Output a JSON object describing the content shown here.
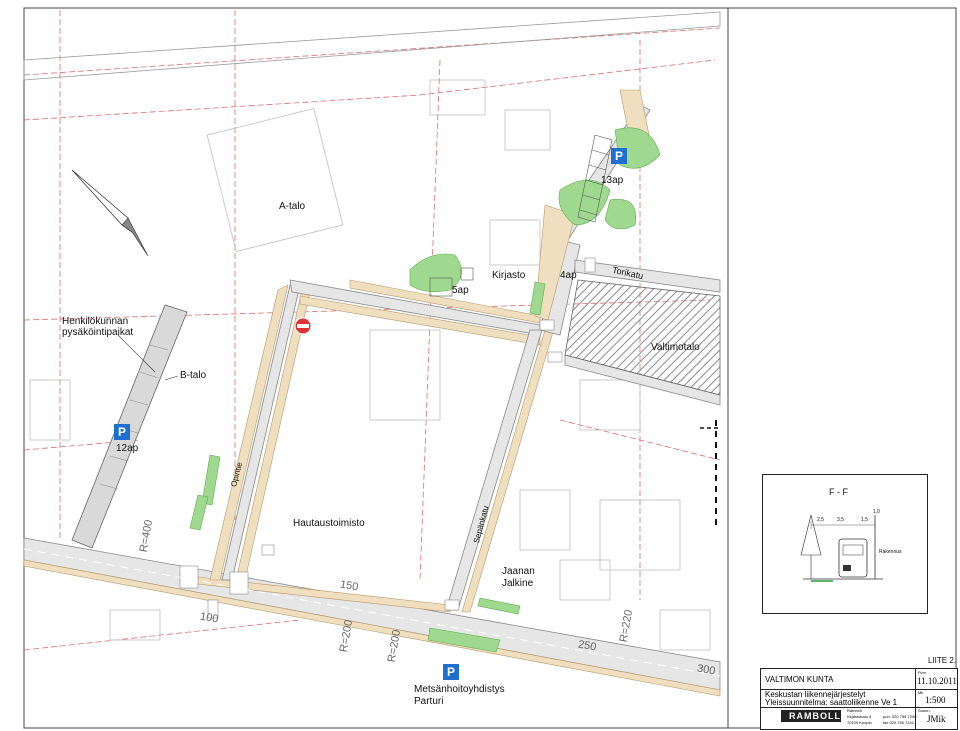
{
  "labels": {
    "a_talo": "A-talo",
    "b_talo": "B-talo",
    "kirjasto": "Kirjasto",
    "valtimotalo": "Valtimotalo",
    "hautaustoimisto": "Hautaustoimisto",
    "jaanan_jalkine_1": "Jaanan",
    "jaanan_jalkine_2": "Jalkine",
    "metsanhoitoyhdistys": "Metsänhoitoyhdistys",
    "parturi": "Parturi",
    "henkilokunnan_1": "Henkilökunnan",
    "henkilokunnan_2": "pysäköintipaikat",
    "parking_12ap": "12ap",
    "parking_13ap": "13ap",
    "parking_5ap": "5ap",
    "parking_4ap": "4ap",
    "torikatu": "Torikatu",
    "sepankatu": "Sepänkatu",
    "opintie": "Opintie",
    "r200": "R=200",
    "r200b": "R=200",
    "r220": "R=220",
    "r400": "R=400",
    "st250": "250",
    "st300": "300",
    "st150": "150",
    "st100": "100",
    "liite": "LIITE 2.",
    "p_symbol": "P"
  },
  "inset": {
    "title": "F - F",
    "label_right": "Rakennus",
    "dim_1": "3,5",
    "dim_2": "2,5",
    "dim_3": "1,5",
    "dim_4": "1,0"
  },
  "titleblock": {
    "client": "VALTIMON KUNTA",
    "date_label": "Pvm",
    "date": "11.10.2011",
    "project_line1": "Keskustan liikennejärjestelyt",
    "project_line2": "Yleissuunnitelma: saattoliikenne Ve 1",
    "scale_label": "Mk",
    "scale": "1:500",
    "company": "RAMBOLL",
    "company_addr1": "Ramboll",
    "company_addr2": "Kirjastokatu 4",
    "company_addr3": "70100 Kuopio",
    "phone": "puh. 020 755 7240",
    "fax": "fax 020 755 7241",
    "designer_label": "Suunn.",
    "designer": "JMik"
  },
  "colors": {
    "road": "#e6e6e6",
    "sidewalk": "#f0dfbf",
    "green": "#9fd98f",
    "building": "#c9c9c9",
    "parking_blue": "#1f6fd1",
    "red_line": "#d84a4a"
  }
}
